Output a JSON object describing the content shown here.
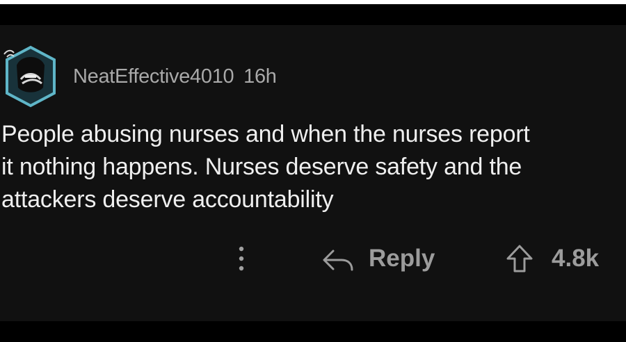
{
  "comment": {
    "username": "NeatEffective4010",
    "time": "16h",
    "text": "People abusing nurses and when the nurses report\nit nothing happens. Nurses deserve safety and the\nattackers deserve accountability"
  },
  "actions": {
    "reply_label": "Reply",
    "score": "4.8k"
  },
  "icons": {
    "more": "more-vertical-icon",
    "reply": "reply-arrow-icon",
    "upvote": "upvote-arrow-icon",
    "avatar": "user-avatar"
  },
  "colors": {
    "background": "#111111",
    "text": "#efefef",
    "muted": "#a9a9a9",
    "avatar_ring": "#5fb6c8"
  }
}
